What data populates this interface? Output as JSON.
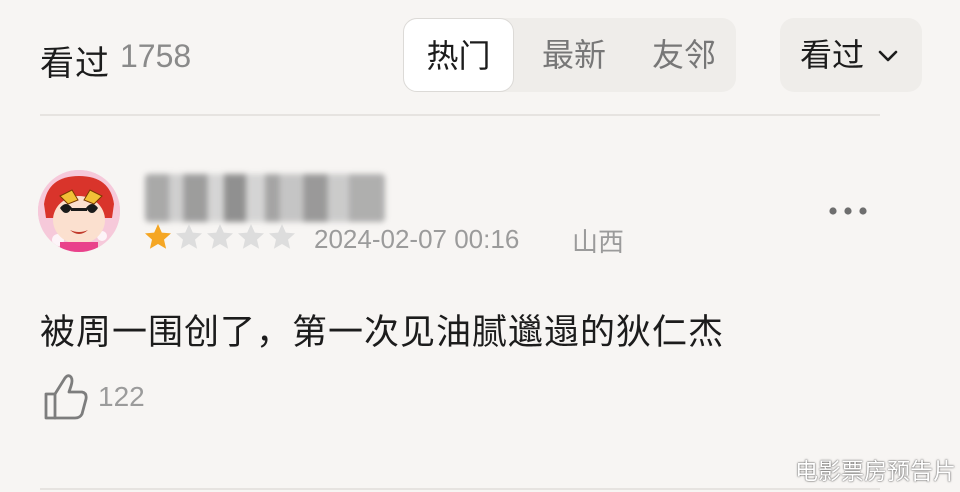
{
  "header": {
    "title": "看过",
    "count": "1758",
    "tabs": [
      {
        "label": "热门",
        "active": true
      },
      {
        "label": "最新",
        "active": false
      },
      {
        "label": "友邻",
        "active": false
      }
    ],
    "filter": {
      "label": "看过",
      "icon": "chevron-down-icon"
    }
  },
  "review": {
    "username": "",
    "rating": {
      "value": 1,
      "max": 5,
      "filled_color": "#f5a623",
      "empty_color": "#dddddd"
    },
    "date": "2024-02-07 00:16",
    "region": "山西",
    "text": "被周一围创了，第一次见油腻邋遢的狄仁杰",
    "likes": "122",
    "more_icon": "more-dots-icon",
    "like_icon": "thumbs-up-icon"
  },
  "watermark": "电影票房预告片",
  "colors": {
    "background": "#f7f5f3",
    "text_primary": "#1c1c1c",
    "text_secondary": "#9b9b9b",
    "accent_star": "#f5a623"
  }
}
